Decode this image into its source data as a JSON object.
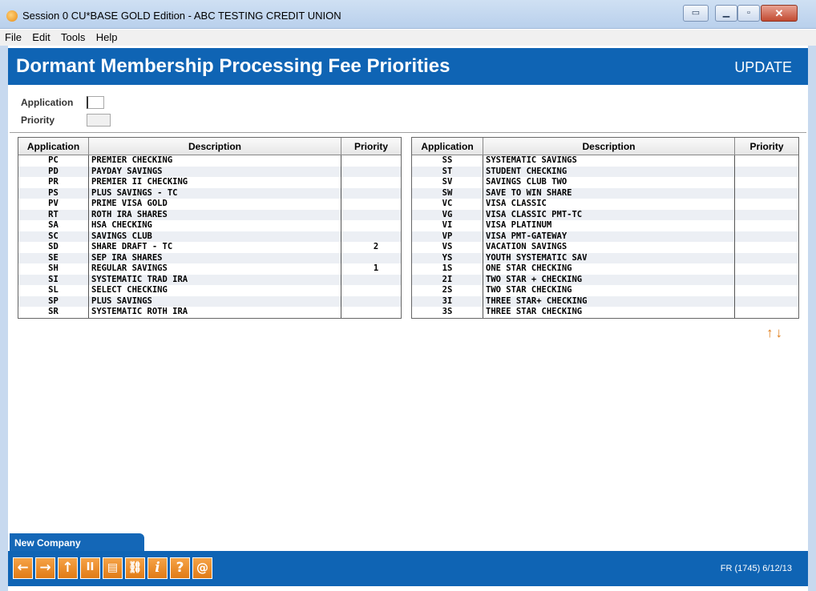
{
  "window": {
    "title": "Session 0 CU*BASE GOLD Edition - ABC TESTING CREDIT UNION"
  },
  "menu": [
    "File",
    "Edit",
    "Tools",
    "Help"
  ],
  "header": {
    "title": "Dormant Membership Processing Fee Priorities",
    "mode": "UPDATE"
  },
  "form": {
    "application_label": "Application",
    "application_value": "",
    "priority_label": "Priority",
    "priority_value": ""
  },
  "columns": {
    "application": "Application",
    "description": "Description",
    "priority": "Priority"
  },
  "left_rows": [
    {
      "app": "PC",
      "desc": "PREMIER CHECKING",
      "priority": ""
    },
    {
      "app": "PD",
      "desc": "PAYDAY SAVINGS",
      "priority": ""
    },
    {
      "app": "PR",
      "desc": "PREMIER II CHECKING",
      "priority": ""
    },
    {
      "app": "PS",
      "desc": "PLUS SAVINGS - TC",
      "priority": ""
    },
    {
      "app": "PV",
      "desc": "PRIME VISA GOLD",
      "priority": ""
    },
    {
      "app": "RT",
      "desc": "ROTH IRA SHARES",
      "priority": ""
    },
    {
      "app": "SA",
      "desc": "HSA CHECKING",
      "priority": ""
    },
    {
      "app": "SC",
      "desc": "SAVINGS CLUB",
      "priority": ""
    },
    {
      "app": "SD",
      "desc": "SHARE DRAFT - TC",
      "priority": "2"
    },
    {
      "app": "SE",
      "desc": "SEP IRA SHARES",
      "priority": ""
    },
    {
      "app": "SH",
      "desc": "REGULAR SAVINGS",
      "priority": "1"
    },
    {
      "app": "SI",
      "desc": "SYSTEMATIC TRAD IRA",
      "priority": ""
    },
    {
      "app": "SL",
      "desc": "SELECT CHECKING",
      "priority": ""
    },
    {
      "app": "SP",
      "desc": "PLUS SAVINGS",
      "priority": ""
    },
    {
      "app": "SR",
      "desc": "SYSTEMATIC ROTH IRA",
      "priority": ""
    }
  ],
  "right_rows": [
    {
      "app": "SS",
      "desc": "SYSTEMATIC SAVINGS",
      "priority": ""
    },
    {
      "app": "ST",
      "desc": "STUDENT CHECKING",
      "priority": ""
    },
    {
      "app": "SV",
      "desc": "SAVINGS CLUB TWO",
      "priority": ""
    },
    {
      "app": "SW",
      "desc": "SAVE TO WIN SHARE",
      "priority": ""
    },
    {
      "app": "VC",
      "desc": "VISA CLASSIC",
      "priority": ""
    },
    {
      "app": "VG",
      "desc": "VISA CLASSIC PMT-TC",
      "priority": ""
    },
    {
      "app": "VI",
      "desc": "VISA PLATINUM",
      "priority": ""
    },
    {
      "app": "VP",
      "desc": "VISA PMT-GATEWAY",
      "priority": ""
    },
    {
      "app": "VS",
      "desc": "VACATION SAVINGS",
      "priority": ""
    },
    {
      "app": "YS",
      "desc": "YOUTH SYSTEMATIC SAV",
      "priority": ""
    },
    {
      "app": "1S",
      "desc": "ONE STAR CHECKING",
      "priority": ""
    },
    {
      "app": "2I",
      "desc": "TWO STAR + CHECKING",
      "priority": ""
    },
    {
      "app": "2S",
      "desc": "TWO STAR CHECKING",
      "priority": ""
    },
    {
      "app": "3I",
      "desc": "THREE STAR+ CHECKING",
      "priority": ""
    },
    {
      "app": "3S",
      "desc": "THREE STAR CHECKING",
      "priority": ""
    }
  ],
  "scroll_arrows": {
    "up": "↑",
    "down": "↓"
  },
  "bottom": {
    "tab_label": "New Company",
    "footer_code": "FR (1745) 6/12/13"
  },
  "toolbar": {
    "back": "←",
    "forward": "→",
    "up": "↑",
    "pause": "II",
    "print": "▤",
    "link": "⛓",
    "info": "i",
    "help": "?",
    "email": "@"
  },
  "colors": {
    "header_blue": "#0f64b4",
    "button_orange": "#e07b16"
  }
}
